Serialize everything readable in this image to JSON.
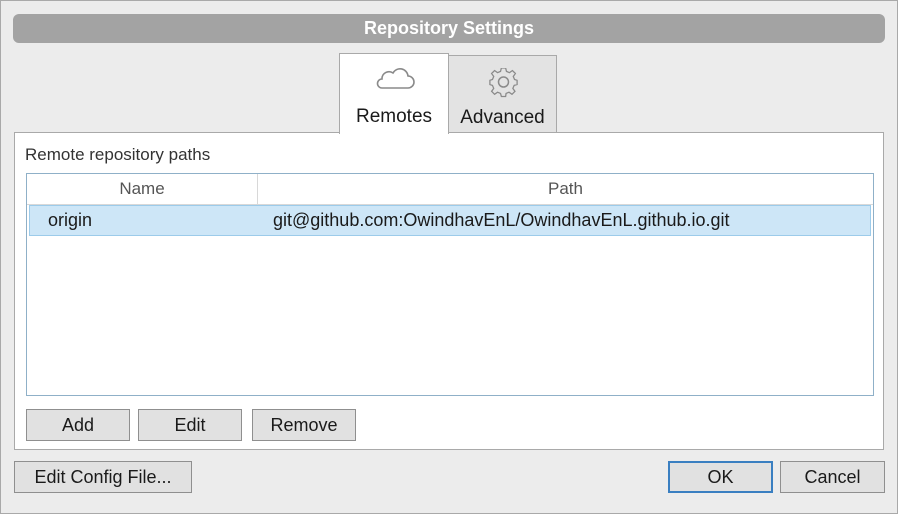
{
  "window": {
    "title": "Repository Settings"
  },
  "tabs": [
    {
      "label": "Remotes",
      "icon": "cloud-icon",
      "selected": true
    },
    {
      "label": "Advanced",
      "icon": "gear-icon",
      "selected": false
    }
  ],
  "remotes": {
    "section_label": "Remote repository paths",
    "columns": [
      "Name",
      "Path"
    ],
    "rows": [
      {
        "name": "origin",
        "path": "git@github.com:OwindhavEnL/OwindhavEnL.github.io.git"
      }
    ],
    "buttons": {
      "add": "Add",
      "edit": "Edit",
      "remove": "Remove"
    }
  },
  "footer": {
    "edit_config": "Edit Config File...",
    "ok": "OK",
    "cancel": "Cancel"
  },
  "colors": {
    "title_bar": "#a3a3a3",
    "selected_row": "#cde6f7",
    "default_button_border": "#3a7fc1"
  }
}
